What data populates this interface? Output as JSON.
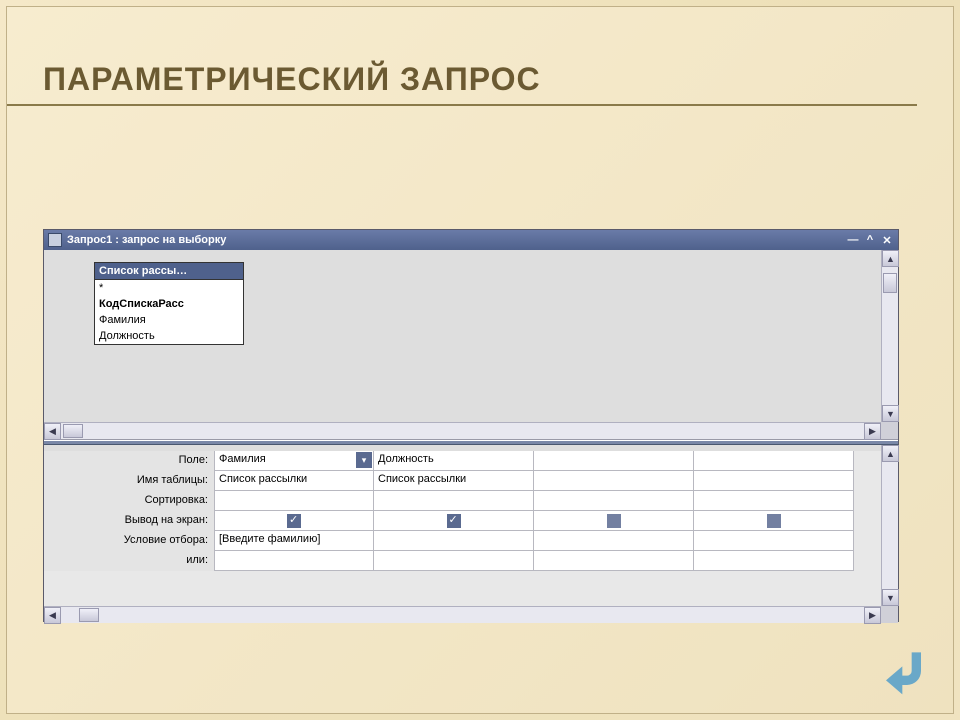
{
  "slide": {
    "title": "ПАРАМЕТРИЧЕСКИЙ ЗАПРОС"
  },
  "window": {
    "caption": "Запрос1 : запрос на выборку",
    "controls": {
      "min": "—",
      "restore": "^",
      "close": "✕"
    }
  },
  "field_list": {
    "header": "Список рассы…",
    "items": [
      "*",
      "КодСпискаРасс",
      "Фамилия",
      "Должность"
    ]
  },
  "grid": {
    "labels": {
      "field": "Поле:",
      "table": "Имя таблицы:",
      "sort": "Сортировка:",
      "show": "Вывод на экран:",
      "criteria": "Условие отбора:",
      "or": "или:"
    },
    "columns": [
      {
        "field": "Фамилия",
        "has_dropdown": true,
        "table": "Список рассылки",
        "sort": "",
        "show": true,
        "criteria": "[Введите фамилию]",
        "or": ""
      },
      {
        "field": "Должность",
        "has_dropdown": false,
        "table": "Список рассылки",
        "sort": "",
        "show": true,
        "criteria": "",
        "or": ""
      },
      {
        "field": "",
        "has_dropdown": false,
        "table": "",
        "sort": "",
        "show": false,
        "criteria": "",
        "or": ""
      },
      {
        "field": "",
        "has_dropdown": false,
        "table": "",
        "sort": "",
        "show": false,
        "criteria": "",
        "or": ""
      }
    ]
  },
  "scroll": {
    "up": "▲",
    "down": "▼",
    "left": "◀",
    "right": "▶"
  }
}
